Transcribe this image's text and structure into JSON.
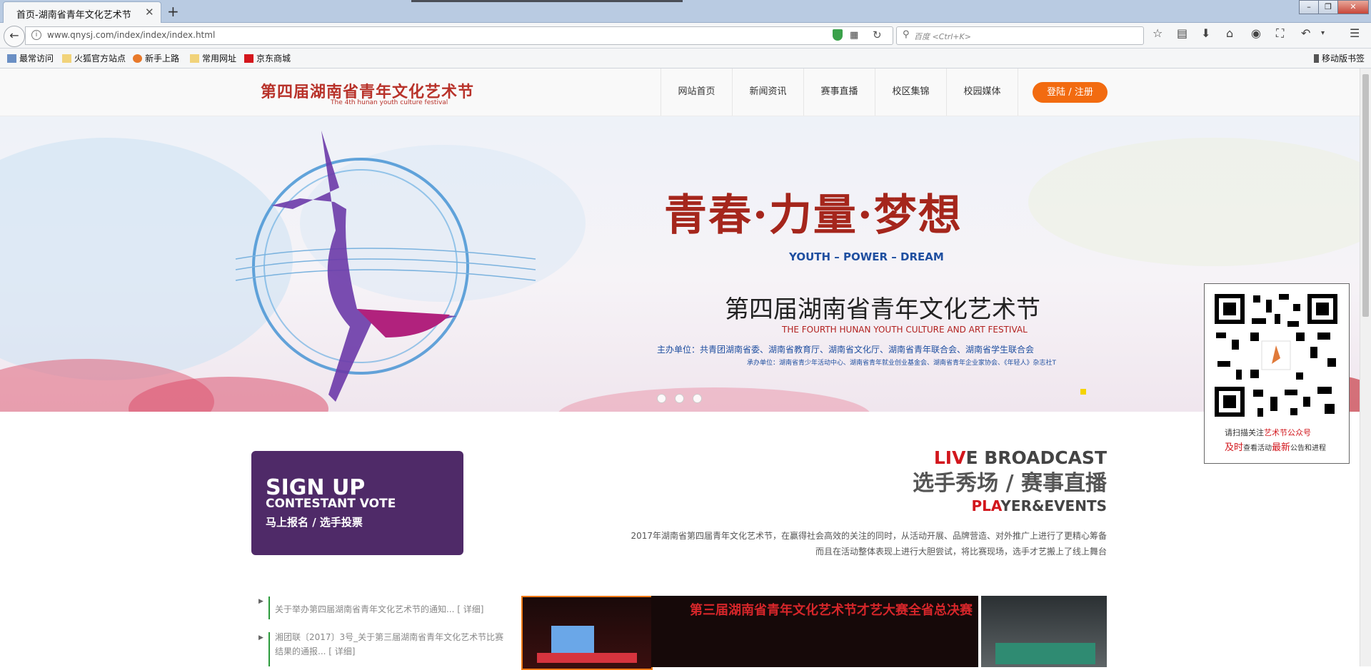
{
  "browser": {
    "tab_title": "首页-湖南省青年文化艺术节",
    "new_tab": "+",
    "url": "www.qnysj.com/index/index/index.html",
    "search_placeholder": "百度 <Ctrl+K>",
    "bookmarks": [
      "最常访问",
      "火狐官方站点",
      "新手上路",
      "常用网址",
      "京东商城"
    ],
    "mobile_bookmarks": "移动版书签"
  },
  "site": {
    "logo_title": "第四届湖南省青年文化艺术节",
    "logo_subtitle": "The 4th hunan youth culture festival",
    "nav": [
      "网站首页",
      "新闻资讯",
      "赛事直播",
      "校区集锦",
      "校园媒体"
    ],
    "login_label": "登陆 / 注册"
  },
  "banner": {
    "slogan": "青春·力量·梦想",
    "slogan_en": "YOUTH – POWER – DREAM",
    "festival_title": "第四届湖南省青年文化艺术节",
    "festival_en": "THE FOURTH HUNAN YOUTH CULTURE AND ART FESTIVAL",
    "host": "主办单位：共青团湖南省委、湖南省教育厅、湖南省文化厅、湖南省青年联合会、湖南省学生联合会",
    "co_host": "承办单位：湖南省青少年活动中心、湖南省青年就业创业基金会、湖南省青年企业家协会、《年轻人》杂志社T",
    "active_dot": 1
  },
  "qr": {
    "line1_pre": "请扫描关注",
    "line1_red": "艺术节公众号",
    "line2_red1": "及时",
    "line2_mid": "查看活动",
    "line2_red2": "最新",
    "line2_post": "公告和进程"
  },
  "signup": {
    "line1": "SIGN UP",
    "line2": "CONTESTANT VOTE",
    "line3": "马上报名 / 选手投票"
  },
  "live": {
    "title_red": "LIV",
    "title_rest": "E BROADCAST",
    "cn_title": "选手秀场 / 赛事直播",
    "player_red": "PLA",
    "player_rest": "YER&EVENTS",
    "desc1": "2017年湖南省第四届青年文化艺术节，在赢得社会高效的关注的同时，从活动开展、品牌营造、对外推广上进行了更精心筹备",
    "desc2": "而且在活动整体表现上进行大胆尝试，将比赛现场，选手才艺搬上了线上舞台"
  },
  "news": [
    "关于举办第四届湖南省青年文化艺术节的通知... [ 详细]",
    "湘团联〔2017〕3号_关于第三届湖南省青年文化艺术节比赛结果的通报... [ 详细]"
  ],
  "thumbs": {
    "middle_caption": "第三届湖南省青年文化艺术节才艺大赛全省总决赛"
  },
  "colors": {
    "accent_orange": "#f26b10",
    "brand_red": "#b8322a",
    "signup_purple": "#4f2a68"
  }
}
